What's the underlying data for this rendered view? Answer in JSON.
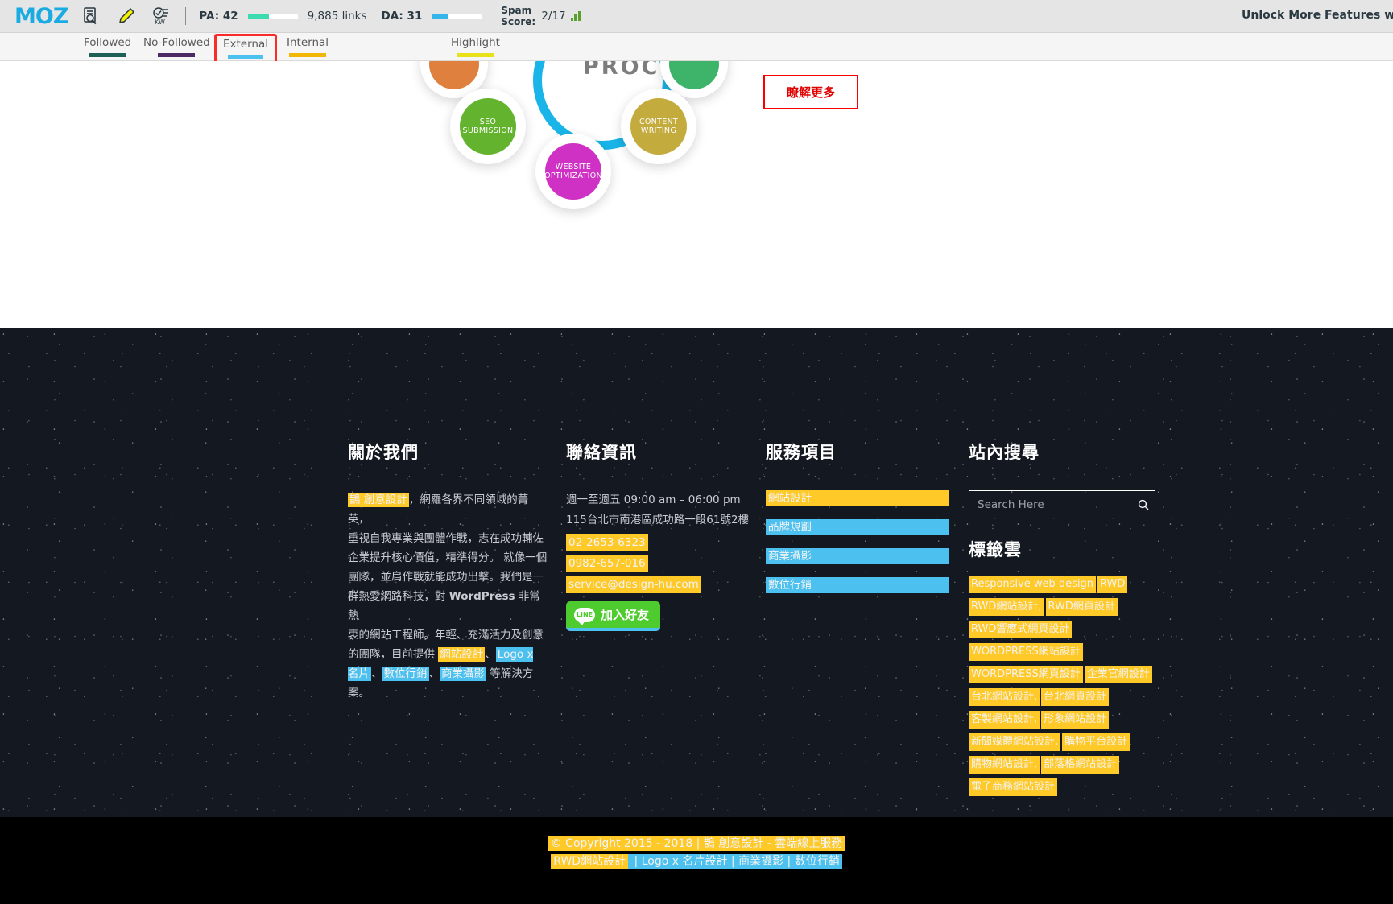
{
  "mozbar": {
    "logo": "MOZ",
    "icons": [
      {
        "name": "page-analysis-icon",
        "glyph": "page-search"
      },
      {
        "name": "highlighter-icon",
        "glyph": "pencil"
      },
      {
        "name": "keyword-icon",
        "glyph": "kw-check"
      }
    ],
    "metrics": [
      {
        "label": "PA: 42",
        "bar_color": "#3ddcb0",
        "bar_pct": 42
      },
      {
        "label": "DA: 31",
        "bar_color": "#36b5ea",
        "bar_pct": 31
      }
    ],
    "links_text": "9,885 links",
    "spam": {
      "label_line1": "Spam",
      "label_line2": "Score:",
      "value": "2/17"
    },
    "cta": "Unlock More Features with MozBar"
  },
  "filters": [
    {
      "label": "Followed",
      "color": "#1f5f55",
      "selected": false
    },
    {
      "label": "No-Followed",
      "color": "#4b2a63",
      "selected": false
    },
    {
      "label": "External",
      "color": "#4cc0ef",
      "selected": true
    },
    {
      "label": "Internal",
      "color": "#f2b705",
      "selected": false
    },
    {
      "label": "Highlight",
      "color": "#e8e019",
      "selected": false
    }
  ],
  "hero": {
    "process_title": "PROCESS",
    "bubbles": [
      {
        "label": "",
        "color": "#e0803f"
      },
      {
        "label": "",
        "color": "#3eb36a"
      },
      {
        "label": "SEO\nSUBMISSION",
        "line1": "SEO",
        "line2": "SUBMISSION",
        "color": "#63b32e"
      },
      {
        "label": "CONTENT\nWRITING",
        "line1": "CONTENT",
        "line2": "WRITING",
        "color": "#c4ab3d"
      },
      {
        "label": "WEBSITE\nOPTIMIZATION",
        "line1": "WEBSITE",
        "line2": "OPTIMIZATION",
        "color": "#cf31c4"
      }
    ],
    "ring_color": "#1ab5e8",
    "more_button": "瞭解更多"
  },
  "footer": {
    "about": {
      "heading": "關於我們",
      "brand_link": "鵲 創意設計",
      "p1": "，網羅各界不同領域的菁英，",
      "p2": "重視自我專業與團體作戰，志在成功輔佐",
      "p3": "企業提升核心價值，精準得分。 就像一個",
      "p4": "團隊，並肩作戰就能成功出擊。我們是一",
      "p5_a": "群熱愛網路科技，對 ",
      "p5_b": "WordPress",
      "p5_c": " 非常熱",
      "p6": "衷的網站工程師。年輕、充滿活力及創意",
      "p7": "的團隊，目前提供 ",
      "link_web": "網站設計",
      "sep1": "、",
      "link_logo": "Logo x 名片",
      "sep2": "、",
      "link_digital": "數位行銷",
      "sep3": "、",
      "link_photo": "商業攝影",
      "tail": " 等解決方案。"
    },
    "contact": {
      "heading": "聯絡資訊",
      "hours": "週一至週五 09:00 am – 06:00 pm",
      "address": "115台北市南港區成功路一段61號2樓",
      "phone1": "02-2653-6323",
      "phone2": "0982-657-016",
      "email": "service@design-hu.com",
      "line_badge": "LINE",
      "line_label": "加入好友"
    },
    "services": {
      "heading": "服務項目",
      "items": [
        {
          "label": "網站設計",
          "color": "y"
        },
        {
          "label": "品牌規劃",
          "color": "b"
        },
        {
          "label": "商業攝影",
          "color": "b"
        },
        {
          "label": "數位行銷",
          "color": "b"
        }
      ]
    },
    "search": {
      "heading": "站內搜尋",
      "placeholder": "Search Here",
      "value": "",
      "icon": "search-icon"
    },
    "tagcloud": {
      "heading": "標籤雲",
      "tags": [
        "Responsive web design",
        "RWD",
        "RWD網站設計,",
        "RWD網頁設計",
        "RWD響應式網頁設計",
        "WORDPRESS網站設計",
        "WORDPRESS網頁設計",
        "企業官網設計",
        "台北網站設計,",
        "台北網頁設計",
        "客製網站設計,",
        "形象網站設計",
        "新聞媒體網站設計,",
        "購物平台設計",
        "購物網站設計,",
        "部落格網站設計",
        "電子商務網站設計"
      ]
    }
  },
  "copyright": {
    "line1_a": "© Copyright 2015 - 2018 | 鵲 創意設計 - 雲端線上服務",
    "line2_a": "RWD網站設計",
    "line2_b": " | Logo x 名片設計 | 商業攝影 | 數位行銷"
  },
  "colors": {
    "yellow": "#ffc928",
    "blue": "#4cc0ef",
    "footer_bg": "#141821",
    "accent_red": "#fa2b2b",
    "moz_blue": "#1aabe3"
  }
}
